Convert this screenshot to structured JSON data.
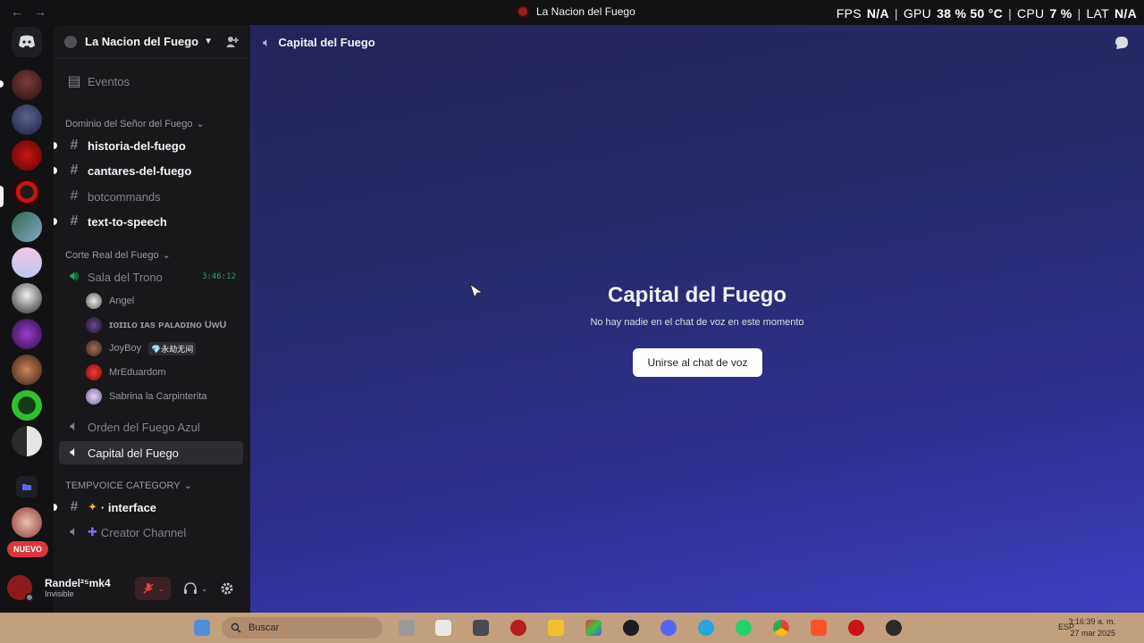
{
  "titlebar": {
    "window_title": "La Nacion del Fuego",
    "overlay": {
      "fps_label": "FPS",
      "fps_value": "N/A",
      "gpu_label": "GPU",
      "gpu_value": "38 % 50 °C",
      "cpu_label": "CPU",
      "cpu_value": "7 %",
      "lat_label": "LAT",
      "lat_value": "N/A"
    }
  },
  "rail": {
    "nuevo_badge": "NUEVO"
  },
  "server": {
    "name": "La Nacion del Fuego",
    "events_label": "Eventos",
    "categories": [
      {
        "name": "Dominio del Señor del Fuego"
      },
      {
        "name": "Corte Real del Fuego"
      },
      {
        "name": "TEMPVOICE CATEGORY"
      }
    ],
    "text_channels": [
      {
        "name": "historia-del-fuego"
      },
      {
        "name": "cantares-del-fuego"
      },
      {
        "name": "botcommands"
      },
      {
        "name": "text-to-speech"
      }
    ],
    "voice_channels": [
      {
        "name": "Sala del Trono",
        "timer": "3:46:12"
      },
      {
        "name": "Orden del Fuego Azul"
      },
      {
        "name": "Capital del Fuego"
      },
      {
        "name": "Creator Channel"
      }
    ],
    "interface_channel": "· interface",
    "voice_users": [
      {
        "name": "Angel"
      },
      {
        "name": "ɪᴏɪɪʟᴏ ɪᴀs ᴘᴀʟᴀᴅɪɴᴏ UwU"
      },
      {
        "name": "JoyBoy",
        "tag": "💎永劫无间"
      },
      {
        "name": "MrEduardom"
      },
      {
        "name": "Sabrina la Carpinterita"
      }
    ]
  },
  "user": {
    "name": "Randel²⁵mk4",
    "status": "Invisible"
  },
  "main": {
    "header_title": "Capital del Fuego",
    "big_title": "Capital del Fuego",
    "subtitle": "No hay nadie en el chat de voz en este momento",
    "join_button": "Unirse al chat de voz"
  },
  "taskbar": {
    "search_placeholder": "Buscar",
    "language": "ESP",
    "time": "3:16:39 a. m.",
    "date": "27 mar 2025"
  },
  "colors": {
    "accent_green": "#23a55a",
    "button_white": "#ffffff",
    "badge_red": "#da373c",
    "taskbar": "#c2a07e"
  }
}
